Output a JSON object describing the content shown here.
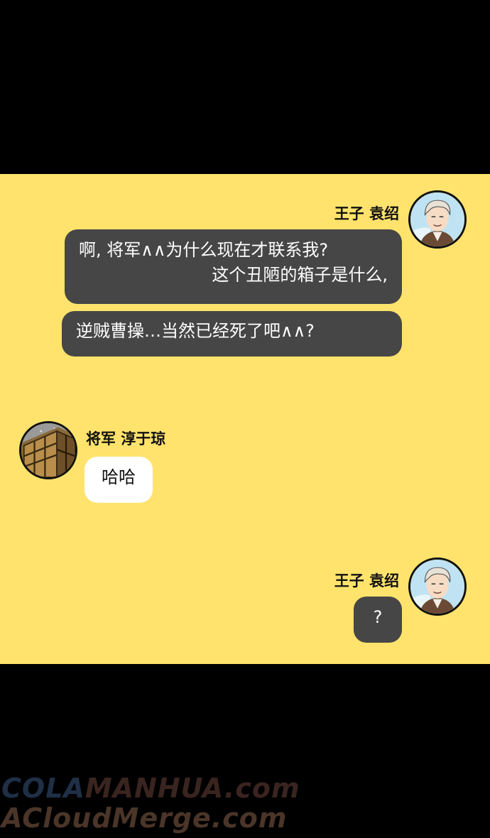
{
  "messages": [
    {
      "sender": "王子 袁绍",
      "side": "right",
      "avatar": "prince-yuanshao-avatar",
      "bubbles": [
        [
          "啊, 将军∧∧为什么现在才联系我?",
          "这个丑陋的箱子是什么,"
        ],
        [
          "逆贼曹操…当然已经死了吧∧∧?"
        ]
      ]
    },
    {
      "sender": "将军 淳于琼",
      "side": "left",
      "avatar": "general-chunyuqiong-avatar",
      "bubbles": [
        [
          "哈哈"
        ]
      ]
    },
    {
      "sender": "王子 袁绍",
      "side": "right",
      "avatar": "prince-yuanshao-avatar",
      "bubbles": [
        [
          "?"
        ]
      ]
    }
  ],
  "watermark": {
    "line1_a": "COLA",
    "line1_b": "MANHUA.com",
    "line2": "ACloudMerge.com"
  },
  "colors": {
    "panel": "#ffe36c",
    "dark_bubble": "#464646",
    "light_bubble": "#ffffff",
    "background": "#000000"
  }
}
